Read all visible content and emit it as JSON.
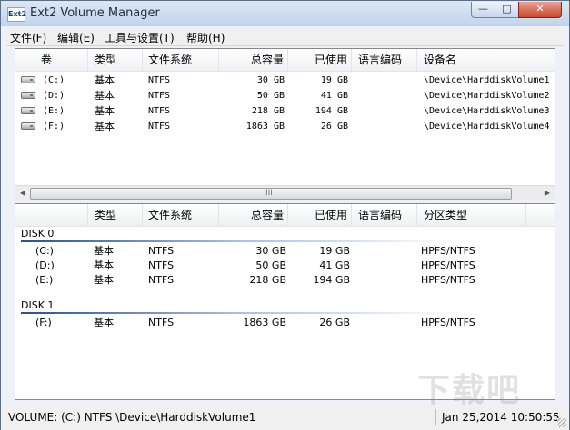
{
  "window": {
    "title": "Ext2 Volume Manager",
    "app_icon_text": "Ext2",
    "minimize": "—",
    "maximize": "□",
    "close": "✕"
  },
  "menu": [
    {
      "label": "文件(F)"
    },
    {
      "label": "编辑(E)"
    },
    {
      "label": "工具与设置(T)"
    },
    {
      "label": "帮助(H)"
    }
  ],
  "volumes": {
    "headers": {
      "vol": "卷",
      "type": "类型",
      "fs": "文件系统",
      "total": "总容量",
      "used": "已使用",
      "codepage": "语言编码",
      "device": "设备名"
    },
    "rows": [
      {
        "vol": "(C:)",
        "type": "基本",
        "fs": "NTFS",
        "total": "30 GB",
        "used": "19 GB",
        "codepage": "",
        "device": "\\Device\\HarddiskVolume1"
      },
      {
        "vol": "(D:)",
        "type": "基本",
        "fs": "NTFS",
        "total": "50 GB",
        "used": "41 GB",
        "codepage": "",
        "device": "\\Device\\HarddiskVolume2"
      },
      {
        "vol": "(E:)",
        "type": "基本",
        "fs": "NTFS",
        "total": "218 GB",
        "used": "194 GB",
        "codepage": "",
        "device": "\\Device\\HarddiskVolume3"
      },
      {
        "vol": "(F:)",
        "type": "基本",
        "fs": "NTFS",
        "total": "1863 GB",
        "used": "26 GB",
        "codepage": "",
        "device": "\\Device\\HarddiskVolume4"
      }
    ],
    "scroll_grip": "III"
  },
  "disks": {
    "headers": {
      "type": "类型",
      "fs": "文件系统",
      "total": "总容量",
      "used": "已使用",
      "codepage": "语言编码",
      "parttype": "分区类型"
    },
    "groups": [
      {
        "name": "DISK 0",
        "rows": [
          {
            "vol": "(C:)",
            "type": "基本",
            "fs": "NTFS",
            "total": "30 GB",
            "used": "19 GB",
            "parttype": "HPFS/NTFS"
          },
          {
            "vol": "(D:)",
            "type": "基本",
            "fs": "NTFS",
            "total": "50 GB",
            "used": "41 GB",
            "parttype": "HPFS/NTFS"
          },
          {
            "vol": "(E:)",
            "type": "基本",
            "fs": "NTFS",
            "total": "218 GB",
            "used": "194 GB",
            "parttype": "HPFS/NTFS"
          }
        ]
      },
      {
        "name": "DISK 1",
        "rows": [
          {
            "vol": "(F:)",
            "type": "基本",
            "fs": "NTFS",
            "total": "1863 GB",
            "used": "26 GB",
            "parttype": "HPFS/NTFS"
          }
        ]
      }
    ]
  },
  "status": {
    "left": "VOLUME: (C:) NTFS \\Device\\HarddiskVolume1",
    "right": "Jan 25,2014 10:50:55"
  },
  "watermark": "下载吧"
}
